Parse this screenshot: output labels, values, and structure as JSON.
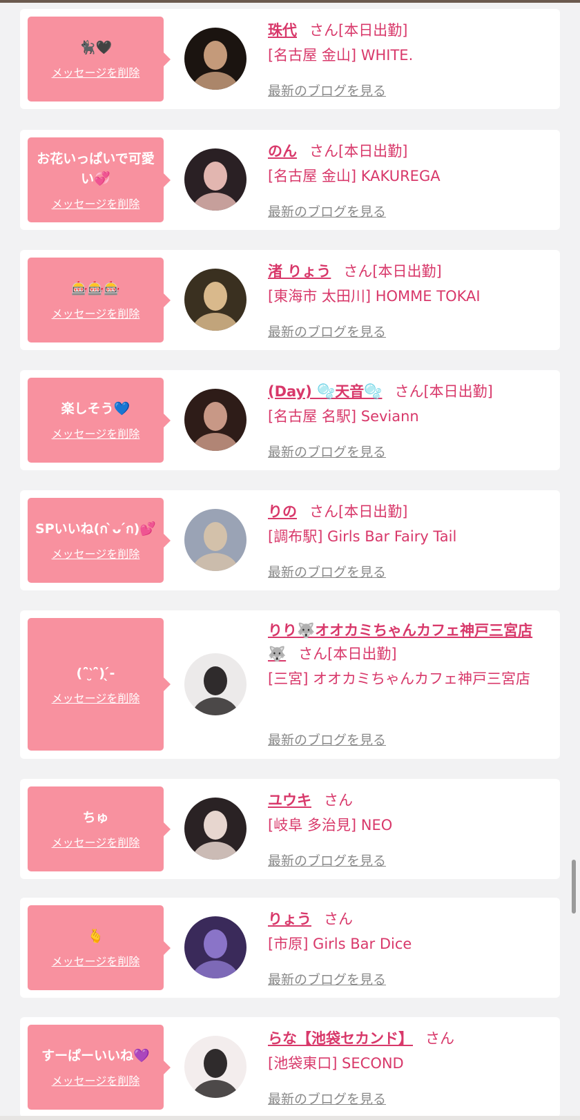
{
  "delete_label": "メッセージを削除",
  "blog_label": "最新のブログを見る",
  "san": "さん",
  "entries": [
    {
      "message": "🐈‍⬛🖤",
      "name": "珠代",
      "status": "[本日出勤]",
      "shop": "[名古屋 金山] WHITE."
    },
    {
      "message": "お花いっぱいで可愛い💞",
      "name": "のん",
      "status": "[本日出勤]",
      "shop": "[名古屋 金山] KAKUREGA"
    },
    {
      "message": "🎰🎰🎰",
      "name": "渚 りょう",
      "status": "[本日出勤]",
      "shop": "[東海市 太田川] HOMME TOKAI"
    },
    {
      "message": "楽しそう💙",
      "name": "(Day) 🫧天音🫧",
      "status": "[本日出勤]",
      "shop": "[名古屋 名駅] Seviann"
    },
    {
      "message": "SPいいね(ก ̀ᴗ ́ก)💕",
      "name": "りの",
      "status": "[本日出勤]",
      "shop": "[調布駅] Girls Bar Fairy Tail"
    },
    {
      "message": "(ˆ̑‵̮ˆ̑)︎ ̖́-‬",
      "name": "りり🐺オオカミちゃんカフェ神戸三宮店🐺",
      "status": "[本日出勤]",
      "shop": "[三宮] オオカミちゃんカフェ神戸三宮店"
    },
    {
      "message": "ちゅ",
      "name": "ユウキ",
      "status": "",
      "shop": "[岐阜 多治見] NEO"
    },
    {
      "message": "🫰",
      "name": "りょう",
      "status": "",
      "shop": "[市原] Girls Bar Dice"
    },
    {
      "message": "すーぱーいいね💜",
      "name": "らな【池袋セカンド】",
      "status": "",
      "shop": "[池袋東口] SECOND"
    }
  ],
  "colors": {
    "bubble": "#f8919f",
    "accent": "#d8386a",
    "link_gray": "#8a8a8a",
    "background": "#f2f2f3"
  },
  "avatar_colors": [
    [
      "#1b1410",
      "#c49a7a"
    ],
    [
      "#2a2024",
      "#e2b6b0"
    ],
    [
      "#3a3020",
      "#d9b98c"
    ],
    [
      "#2e1c18",
      "#c89886"
    ],
    [
      "#9aa3b5",
      "#d3c1aa"
    ],
    [
      "#eceaea",
      "#2f2b2c"
    ],
    [
      "#2a2224",
      "#e7d6cf"
    ],
    [
      "#3a2a5a",
      "#8a74c8"
    ],
    [
      "#f3eded",
      "#2f2b2c"
    ]
  ]
}
